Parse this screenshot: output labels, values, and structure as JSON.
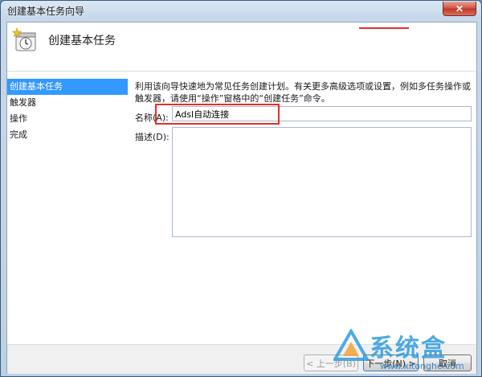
{
  "window": {
    "title": "创建基本任务向导",
    "close_label": "✕"
  },
  "header": {
    "title": "创建基本任务",
    "icon": "task-scheduler-clock-icon"
  },
  "nav": {
    "items": [
      {
        "label": "创建基本任务",
        "active": true
      },
      {
        "label": "触发器",
        "active": false
      },
      {
        "label": "操作",
        "active": false
      },
      {
        "label": "完成",
        "active": false
      }
    ]
  },
  "main": {
    "description": "利用该向导快速地为常见任务创建计划。有关更多高级选项或设置，例如多任务操作或触发器，请使用“操作”窗格中的“创建任务”命令。",
    "name_label": "名称(A):",
    "name_value": "Adsl自动连接",
    "desc_label": "描述(D):",
    "desc_value": ""
  },
  "footer": {
    "back_label": "< 上一步(B)",
    "next_label": "下一步(N) >",
    "cancel_label": "取消"
  },
  "watermark": {
    "text": "系统盒",
    "url": "www.xitonghe.com"
  },
  "colors": {
    "nav_active": "#3399ff",
    "highlight": "#e0302a",
    "watermark": "#2f9be0"
  }
}
